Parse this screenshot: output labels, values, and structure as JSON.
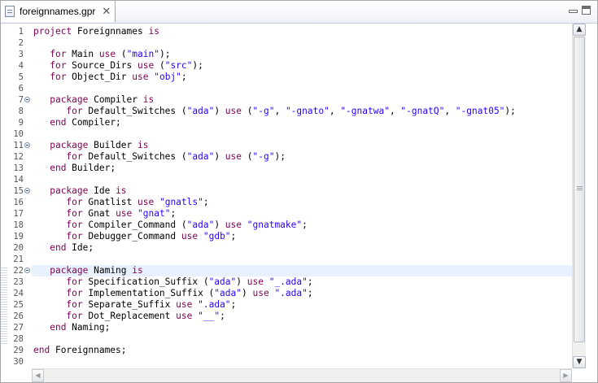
{
  "tab": {
    "title": "foreignnames.gpr",
    "close_glyph": "✕"
  },
  "gutter": {
    "line_numbers": [
      "1",
      "2",
      "3",
      "4",
      "5",
      "6",
      "7",
      "8",
      "9",
      "10",
      "11",
      "12",
      "13",
      "14",
      "15",
      "16",
      "17",
      "18",
      "19",
      "20",
      "21",
      "22",
      "23",
      "24",
      "25",
      "26",
      "27",
      "28",
      "29",
      "30"
    ],
    "fold_markers_at_lines": [
      7,
      11,
      15,
      22
    ]
  },
  "current_line": 22,
  "colors": {
    "keyword": "#7f0055",
    "string": "#2a00ff",
    "current_line_bg": "#e8f2fe"
  },
  "code_lines": [
    [
      {
        "t": "project",
        "k": "kw"
      },
      {
        "t": " Foreignnames "
      },
      {
        "t": "is",
        "k": "kw"
      }
    ],
    [],
    [
      {
        "t": "   "
      },
      {
        "t": "for",
        "k": "kw"
      },
      {
        "t": " Main "
      },
      {
        "t": "use",
        "k": "kw"
      },
      {
        "t": " ("
      },
      {
        "t": "\"main\"",
        "k": "str"
      },
      {
        "t": ");"
      }
    ],
    [
      {
        "t": "   "
      },
      {
        "t": "for",
        "k": "kw"
      },
      {
        "t": " Source_Dirs "
      },
      {
        "t": "use",
        "k": "kw"
      },
      {
        "t": " ("
      },
      {
        "t": "\"src\"",
        "k": "str"
      },
      {
        "t": ");"
      }
    ],
    [
      {
        "t": "   "
      },
      {
        "t": "for",
        "k": "kw"
      },
      {
        "t": " Object_Dir "
      },
      {
        "t": "use",
        "k": "kw"
      },
      {
        "t": " "
      },
      {
        "t": "\"obj\"",
        "k": "str"
      },
      {
        "t": ";"
      }
    ],
    [],
    [
      {
        "t": "   "
      },
      {
        "t": "package",
        "k": "kw"
      },
      {
        "t": " Compiler "
      },
      {
        "t": "is",
        "k": "kw"
      }
    ],
    [
      {
        "t": "      "
      },
      {
        "t": "for",
        "k": "kw"
      },
      {
        "t": " Default_Switches ("
      },
      {
        "t": "\"ada\"",
        "k": "str"
      },
      {
        "t": ") "
      },
      {
        "t": "use",
        "k": "kw"
      },
      {
        "t": " ("
      },
      {
        "t": "\"-g\"",
        "k": "str"
      },
      {
        "t": ", "
      },
      {
        "t": "\"-gnato\"",
        "k": "str"
      },
      {
        "t": ", "
      },
      {
        "t": "\"-gnatwa\"",
        "k": "str"
      },
      {
        "t": ", "
      },
      {
        "t": "\"-gnatQ\"",
        "k": "str"
      },
      {
        "t": ", "
      },
      {
        "t": "\"-gnat05\"",
        "k": "str"
      },
      {
        "t": ");"
      }
    ],
    [
      {
        "t": "   "
      },
      {
        "t": "end",
        "k": "kw"
      },
      {
        "t": " Compiler;"
      }
    ],
    [],
    [
      {
        "t": "   "
      },
      {
        "t": "package",
        "k": "kw"
      },
      {
        "t": " Builder "
      },
      {
        "t": "is",
        "k": "kw"
      }
    ],
    [
      {
        "t": "      "
      },
      {
        "t": "for",
        "k": "kw"
      },
      {
        "t": " Default_Switches ("
      },
      {
        "t": "\"ada\"",
        "k": "str"
      },
      {
        "t": ") "
      },
      {
        "t": "use",
        "k": "kw"
      },
      {
        "t": " ("
      },
      {
        "t": "\"-g\"",
        "k": "str"
      },
      {
        "t": ");"
      }
    ],
    [
      {
        "t": "   "
      },
      {
        "t": "end",
        "k": "kw"
      },
      {
        "t": " Builder;"
      }
    ],
    [],
    [
      {
        "t": "   "
      },
      {
        "t": "package",
        "k": "kw"
      },
      {
        "t": " Ide "
      },
      {
        "t": "is",
        "k": "kw"
      }
    ],
    [
      {
        "t": "      "
      },
      {
        "t": "for",
        "k": "kw"
      },
      {
        "t": " Gnatlist "
      },
      {
        "t": "use",
        "k": "kw"
      },
      {
        "t": " "
      },
      {
        "t": "\"gnatls\"",
        "k": "str"
      },
      {
        "t": ";"
      }
    ],
    [
      {
        "t": "      "
      },
      {
        "t": "for",
        "k": "kw"
      },
      {
        "t": " Gnat "
      },
      {
        "t": "use",
        "k": "kw"
      },
      {
        "t": " "
      },
      {
        "t": "\"gnat\"",
        "k": "str"
      },
      {
        "t": ";"
      }
    ],
    [
      {
        "t": "      "
      },
      {
        "t": "for",
        "k": "kw"
      },
      {
        "t": " Compiler_Command ("
      },
      {
        "t": "\"ada\"",
        "k": "str"
      },
      {
        "t": ") "
      },
      {
        "t": "use",
        "k": "kw"
      },
      {
        "t": " "
      },
      {
        "t": "\"gnatmake\"",
        "k": "str"
      },
      {
        "t": ";"
      }
    ],
    [
      {
        "t": "      "
      },
      {
        "t": "for",
        "k": "kw"
      },
      {
        "t": " Debugger_Command "
      },
      {
        "t": "use",
        "k": "kw"
      },
      {
        "t": " "
      },
      {
        "t": "\"gdb\"",
        "k": "str"
      },
      {
        "t": ";"
      }
    ],
    [
      {
        "t": "   "
      },
      {
        "t": "end",
        "k": "kw"
      },
      {
        "t": " Ide;"
      }
    ],
    [],
    [
      {
        "t": "   "
      },
      {
        "t": "package",
        "k": "kw"
      },
      {
        "t": " Naming "
      },
      {
        "t": "is",
        "k": "kw"
      }
    ],
    [
      {
        "t": "      "
      },
      {
        "t": "for",
        "k": "kw"
      },
      {
        "t": " Specification_Suffix ("
      },
      {
        "t": "\"ada\"",
        "k": "str"
      },
      {
        "t": ") "
      },
      {
        "t": "use",
        "k": "kw"
      },
      {
        "t": " "
      },
      {
        "t": "\"_.ada\"",
        "k": "str"
      },
      {
        "t": ";"
      }
    ],
    [
      {
        "t": "      "
      },
      {
        "t": "for",
        "k": "kw"
      },
      {
        "t": " Implementation_Suffix ("
      },
      {
        "t": "\"ada\"",
        "k": "str"
      },
      {
        "t": ") "
      },
      {
        "t": "use",
        "k": "kw"
      },
      {
        "t": " "
      },
      {
        "t": "\".ada\"",
        "k": "str"
      },
      {
        "t": ";"
      }
    ],
    [
      {
        "t": "      "
      },
      {
        "t": "for",
        "k": "kw"
      },
      {
        "t": " Separate_Suffix "
      },
      {
        "t": "use",
        "k": "kw"
      },
      {
        "t": " "
      },
      {
        "t": "\".ada\"",
        "k": "str"
      },
      {
        "t": ";"
      }
    ],
    [
      {
        "t": "      "
      },
      {
        "t": "for",
        "k": "kw"
      },
      {
        "t": " Dot_Replacement "
      },
      {
        "t": "use",
        "k": "kw"
      },
      {
        "t": " "
      },
      {
        "t": "\"__\"",
        "k": "str"
      },
      {
        "t": ";"
      }
    ],
    [
      {
        "t": "   "
      },
      {
        "t": "end",
        "k": "kw"
      },
      {
        "t": " Naming;"
      }
    ],
    [],
    [
      {
        "t": "end",
        "k": "kw"
      },
      {
        "t": " Foreignnames;"
      }
    ],
    []
  ],
  "scrollbar": {
    "up_glyph": "▲",
    "down_glyph": "▼",
    "left_glyph": "◀",
    "right_glyph": "▶"
  }
}
